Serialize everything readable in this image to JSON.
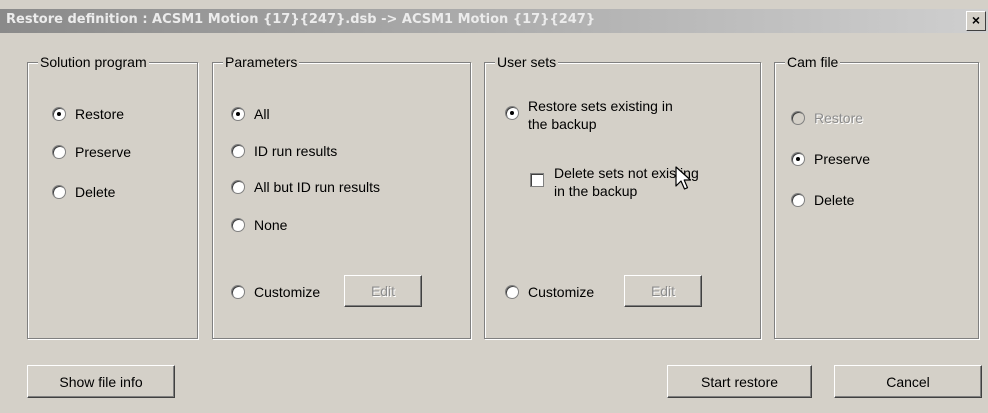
{
  "window": {
    "title": "Restore definition : ACSM1 Motion {17}{247}.dsb -> ACSM1 Motion {17}{247}",
    "close_label": "×"
  },
  "solution_program": {
    "legend": "Solution program",
    "options": [
      {
        "label": "Restore",
        "checked": true
      },
      {
        "label": "Preserve",
        "checked": false
      },
      {
        "label": "Delete",
        "checked": false
      }
    ]
  },
  "parameters": {
    "legend": "Parameters",
    "options": [
      {
        "label": "All",
        "checked": true
      },
      {
        "label": "ID run results",
        "checked": false
      },
      {
        "label": "All but ID run results",
        "checked": false
      },
      {
        "label": "None",
        "checked": false
      },
      {
        "label": "Customize",
        "checked": false
      }
    ],
    "edit_label": "Edit"
  },
  "user_sets": {
    "legend": "User sets",
    "restore_line1": "Restore sets existing in",
    "restore_line2": "the backup",
    "delete_line1": "Delete sets not existing",
    "delete_line2": "in the backup",
    "delete_checked": false,
    "customize_label": "Customize",
    "edit_label": "Edit"
  },
  "cam_file": {
    "legend": "Cam file",
    "options": [
      {
        "label": "Restore",
        "checked": false,
        "disabled": true
      },
      {
        "label": "Preserve",
        "checked": true,
        "disabled": false
      },
      {
        "label": "Delete",
        "checked": false,
        "disabled": false
      }
    ]
  },
  "buttons": {
    "show_file_info": "Show file info",
    "start_restore": "Start restore",
    "cancel": "Cancel"
  }
}
